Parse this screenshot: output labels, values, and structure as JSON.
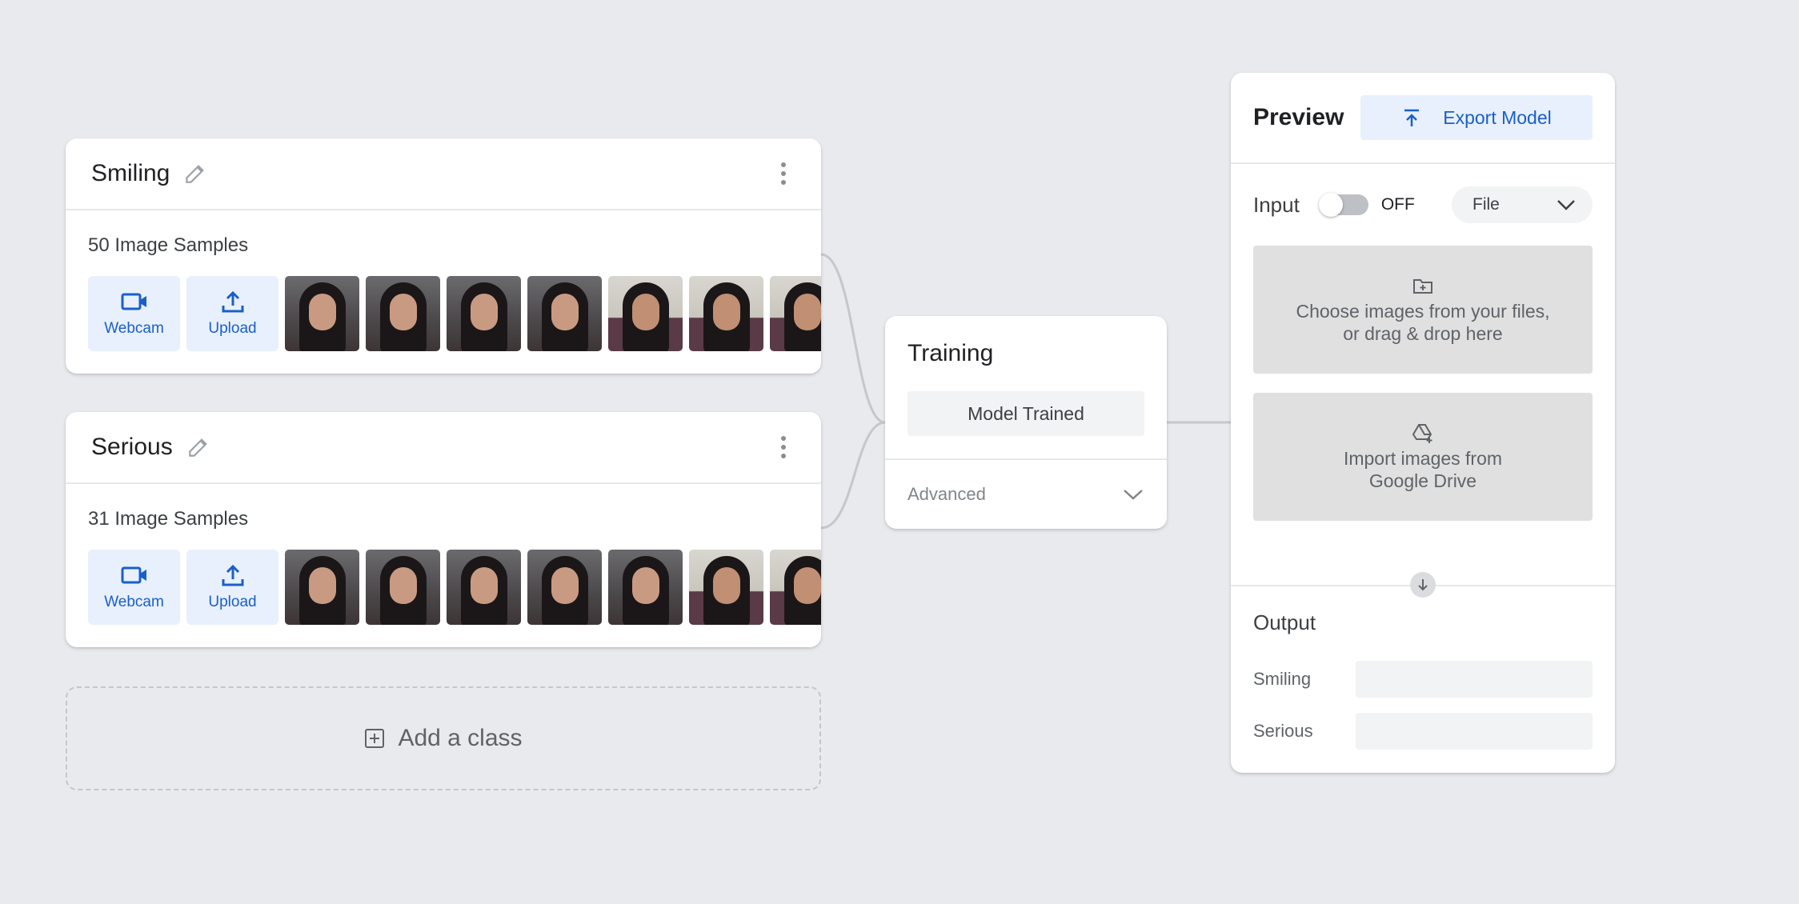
{
  "classes": [
    {
      "name": "Smiling",
      "samples_label": "50 Image Samples",
      "webcam_label": "Webcam",
      "upload_label": "Upload",
      "thumbs": [
        "dark",
        "dark",
        "dark",
        "dark",
        "light",
        "light",
        "light"
      ]
    },
    {
      "name": "Serious",
      "samples_label": "31 Image Samples",
      "webcam_label": "Webcam",
      "upload_label": "Upload",
      "thumbs": [
        "dark",
        "dark",
        "dark",
        "dark",
        "dark",
        "light",
        "light"
      ]
    }
  ],
  "add_class_label": "Add a class",
  "training": {
    "title": "Training",
    "trained_button": "Model Trained",
    "advanced_label": "Advanced"
  },
  "preview": {
    "title": "Preview",
    "export_button": "Export Model",
    "input_label": "Input",
    "toggle_state": "OFF",
    "source_select": "File",
    "drop_line1": "Choose images from your files,",
    "drop_line2": "or drag & drop here",
    "drive_line1": "Import images from",
    "drive_line2": "Google Drive",
    "output_title": "Output",
    "outputs": [
      {
        "label": "Smiling",
        "value": 0
      },
      {
        "label": "Serious",
        "value": 0
      }
    ]
  },
  "colors": {
    "accent": "#1a5fc9",
    "accent_bg": "#e8f0fe",
    "background": "#e8eaee"
  }
}
